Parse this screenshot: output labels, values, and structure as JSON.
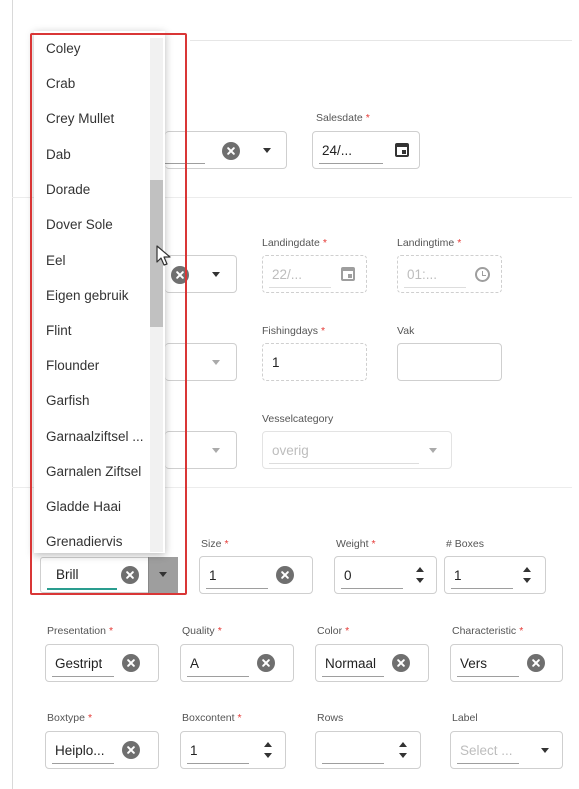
{
  "dropdown": {
    "options": [
      "Coley",
      "Crab",
      "Crey Mullet",
      "Dab",
      "Dorade",
      "Dover Sole",
      "Eel",
      "Eigen gebruik",
      "Flint",
      "Flounder",
      "Garfish",
      "Garnaalziftsel ...",
      "Garnalen Ziftsel",
      "Gladde Haai",
      "Grenadiervis"
    ]
  },
  "header": {
    "salesdate": {
      "label": "Salesdate",
      "value": "24/..."
    }
  },
  "landing": {
    "landingdate": {
      "label": "Landingdate",
      "value": "22/..."
    },
    "landingtime": {
      "label": "Landingtime",
      "value": "01:..."
    }
  },
  "fishing": {
    "fishingdays": {
      "label": "Fishingdays",
      "value": "1"
    },
    "vak": {
      "label": "Vak",
      "value": ""
    }
  },
  "vessel": {
    "vesselcategory": {
      "label": "Vesselcategory",
      "value": "overig"
    }
  },
  "line": {
    "species": {
      "value": "Brill"
    },
    "size": {
      "label": "Size",
      "value": "1"
    },
    "weight": {
      "label": "Weight",
      "value": "0"
    },
    "boxes": {
      "label": "# Boxes",
      "value": "1"
    },
    "presentation": {
      "label": "Presentation",
      "value": "Gestript"
    },
    "quality": {
      "label": "Quality",
      "value": "A"
    },
    "color": {
      "label": "Color",
      "value": "Normaal"
    },
    "characteristic": {
      "label": "Characteristic",
      "value": "Vers"
    },
    "boxtype": {
      "label": "Boxtype",
      "value": "Heiplo..."
    },
    "boxcontent": {
      "label": "Boxcontent",
      "value": "1"
    },
    "rows": {
      "label": "Rows",
      "value": ""
    },
    "label": {
      "label": "Label",
      "placeholder": "Select ..."
    }
  },
  "required_mark": "*",
  "colors": {
    "highlight": "#d93636",
    "accent": "#2a9d8f",
    "required": "#e53935"
  }
}
